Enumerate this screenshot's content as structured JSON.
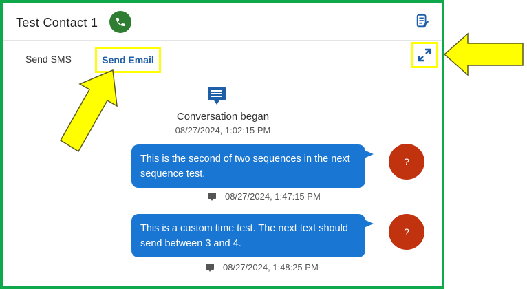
{
  "header": {
    "contact_name": "Test Contact 1",
    "call_icon": "phone-icon",
    "notes_icon": "note-edit-icon"
  },
  "tabs": {
    "sms_label": "Send SMS",
    "email_label": "Send Email",
    "expand_icon": "expand-icon"
  },
  "conversation": {
    "start_icon": "chat-icon",
    "start_label": "Conversation began",
    "start_time": "08/27/2024, 1:02:15 PM"
  },
  "messages": [
    {
      "text": "This is the second of two sequences in the next sequence test.",
      "avatar": "?",
      "time": "08/27/2024, 1:47:15 PM"
    },
    {
      "text": "This is a custom time test. The next text should send between 3 and 4.",
      "avatar": "?",
      "time": "08/27/2024, 1:48:25 PM"
    }
  ],
  "colors": {
    "frame_border": "#0fa84a",
    "highlight": "#ffff00",
    "bubble": "#1976d2",
    "avatar": "#c1320f",
    "call_button": "#2e7d32",
    "link": "#1f5fa8"
  }
}
